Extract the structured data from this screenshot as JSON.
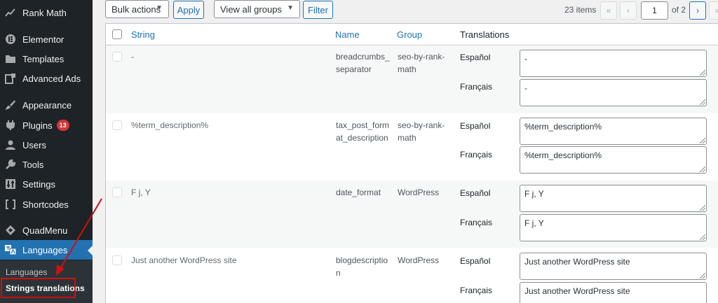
{
  "sidebar": {
    "items": [
      {
        "label": "Rank Math",
        "icon": "rank-math-icon"
      },
      {
        "label": "Elementor",
        "icon": "elementor-icon"
      },
      {
        "label": "Templates",
        "icon": "folder-icon"
      },
      {
        "label": "Advanced Ads",
        "icon": "ads-icon"
      },
      {
        "label": "Appearance",
        "icon": "brush-icon"
      },
      {
        "label": "Plugins",
        "icon": "plug-icon",
        "badge": "13"
      },
      {
        "label": "Users",
        "icon": "user-icon"
      },
      {
        "label": "Tools",
        "icon": "wrench-icon"
      },
      {
        "label": "Settings",
        "icon": "settings-icon"
      },
      {
        "label": "Shortcodes",
        "icon": "brackets-icon"
      },
      {
        "label": "QuadMenu",
        "icon": "quadmenu-icon"
      },
      {
        "label": "Languages",
        "icon": "translate-icon",
        "active": true
      }
    ],
    "submenu": [
      {
        "label": "Languages"
      },
      {
        "label": "Strings translations",
        "current": true
      }
    ]
  },
  "toolbar": {
    "bulk_actions": "Bulk actions",
    "apply_label": "Apply",
    "group_filter": "View all groups",
    "filter_label": "Filter"
  },
  "pagination": {
    "items_count": "23 items",
    "first": "«",
    "prev": "‹",
    "current_page": "1",
    "of_total": "of 2",
    "next": "›",
    "last": "»"
  },
  "table": {
    "headers": {
      "string": "String",
      "name": "Name",
      "group": "Group",
      "translations": "Translations"
    },
    "rows": [
      {
        "string": "-",
        "name_lines": [
          "breadcrumbs_",
          "separator"
        ],
        "group_lines": [
          "seo-by-rank-",
          "math"
        ],
        "translations": [
          {
            "lang": "Español",
            "value": "-"
          },
          {
            "lang": "Français",
            "value": "-"
          }
        ]
      },
      {
        "string": "%term_description%",
        "name_lines": [
          "tax_post_form",
          "at_description"
        ],
        "group_lines": [
          "seo-by-rank-",
          "math"
        ],
        "translations": [
          {
            "lang": "Español",
            "value": "%term_description%"
          },
          {
            "lang": "Français",
            "value": "%term_description%"
          }
        ]
      },
      {
        "string": "F j, Y",
        "name_lines": [
          "date_format"
        ],
        "group_lines": [
          "WordPress"
        ],
        "translations": [
          {
            "lang": "Español",
            "value": "F j, Y"
          },
          {
            "lang": "Français",
            "value": "F j, Y"
          }
        ]
      },
      {
        "string": "Just another WordPress site",
        "name_lines": [
          "blogdescriptio",
          "n"
        ],
        "group_lines": [
          "WordPress"
        ],
        "translations": [
          {
            "lang": "Español",
            "value": "Just another WordPress site"
          },
          {
            "lang": "Français",
            "value": "Just another WordPress site"
          }
        ]
      }
    ]
  },
  "colors": {
    "accent": "#2271b1",
    "sidebar_bg": "#1d2327",
    "badge": "#d63638",
    "annotation": "#d10f0f"
  }
}
